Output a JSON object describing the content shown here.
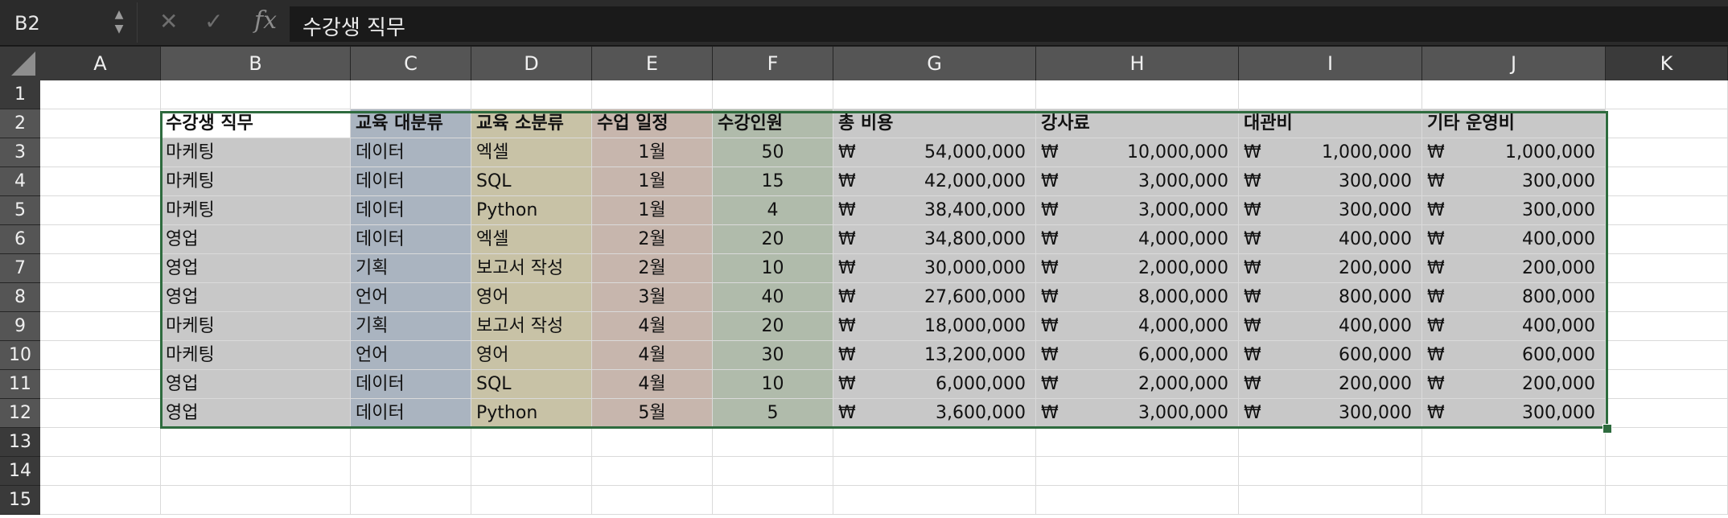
{
  "formula_bar": {
    "name_box": "B2",
    "fx_label": "fx",
    "content": "수강생 직무"
  },
  "icons": {
    "cancel": "close-icon",
    "confirm": "check-icon",
    "function": "fx-icon"
  },
  "columns": [
    "A",
    "B",
    "C",
    "D",
    "E",
    "F",
    "G",
    "H",
    "I",
    "J",
    "K"
  ],
  "rows": [
    "1",
    "2",
    "3",
    "4",
    "5",
    "6",
    "7",
    "8",
    "9",
    "10",
    "11",
    "12",
    "13",
    "14",
    "15"
  ],
  "selection": {
    "active_cell": "B2",
    "range": "B2:J12"
  },
  "currency_symbol": "₩",
  "table": {
    "headers": [
      "수강생 직무",
      "교육 대분류",
      "교육 소분류",
      "수업 일정",
      "수강인원",
      "총 비용",
      "강사료",
      "대관비",
      "기타 운영비"
    ],
    "rows": [
      [
        "마케팅",
        "데이터",
        "엑셀",
        "1월",
        "50",
        "54,000,000",
        "10,000,000",
        "1,000,000",
        "1,000,000"
      ],
      [
        "마케팅",
        "데이터",
        "SQL",
        "1월",
        "15",
        "42,000,000",
        "3,000,000",
        "300,000",
        "300,000"
      ],
      [
        "마케팅",
        "데이터",
        "Python",
        "1월",
        "4",
        "38,400,000",
        "3,000,000",
        "300,000",
        "300,000"
      ],
      [
        "영업",
        "데이터",
        "엑셀",
        "2월",
        "20",
        "34,800,000",
        "4,000,000",
        "400,000",
        "400,000"
      ],
      [
        "영업",
        "기획",
        "보고서 작성",
        "2월",
        "10",
        "30,000,000",
        "2,000,000",
        "200,000",
        "200,000"
      ],
      [
        "영업",
        "언어",
        "영어",
        "3월",
        "40",
        "27,600,000",
        "8,000,000",
        "800,000",
        "800,000"
      ],
      [
        "마케팅",
        "기획",
        "보고서 작성",
        "4월",
        "20",
        "18,000,000",
        "4,000,000",
        "400,000",
        "400,000"
      ],
      [
        "마케팅",
        "언어",
        "영어",
        "4월",
        "30",
        "13,200,000",
        "6,000,000",
        "600,000",
        "600,000"
      ],
      [
        "영업",
        "데이터",
        "SQL",
        "4월",
        "10",
        "6,000,000",
        "2,000,000",
        "200,000",
        "200,000"
      ],
      [
        "영업",
        "데이터",
        "Python",
        "5월",
        "5",
        "3,600,000",
        "3,000,000",
        "300,000",
        "300,000"
      ]
    ]
  },
  "column_fills": {
    "B": "#c8c8c8",
    "C": "#aab4c0",
    "D": "#c8c2a6",
    "E": "#c7b6ad",
    "F": "#b0bbab",
    "G": "#c8c8c8",
    "H": "#c8c8c8",
    "I": "#c8c8c8",
    "J": "#c8c8c8",
    "header_B": "#ffffff"
  }
}
